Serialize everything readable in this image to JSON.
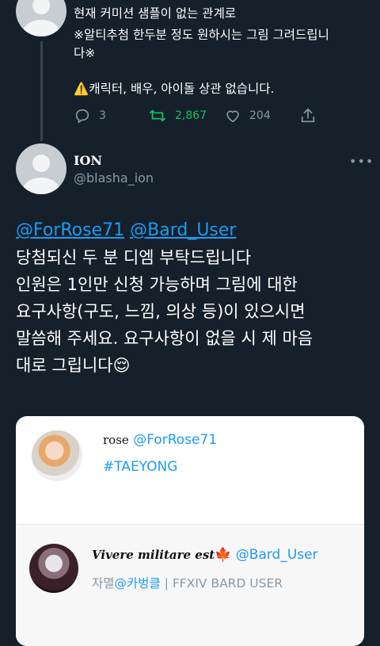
{
  "prev_tweet": {
    "lines": [
      "현재 커미션 샘플이 없는 관계로",
      "※알티추첨 한두분 정도 원하시는 그림 그려드립니",
      "다※"
    ],
    "warning_icon": "⚠️",
    "warning_text": "캐릭터, 배우, 아이돌 상관 없습니다.",
    "actions": {
      "replies": "3",
      "retweets": "2,867",
      "likes": "204"
    }
  },
  "tweet": {
    "name": "ION",
    "handle": "@blasha_ion",
    "more": "•••",
    "mention_1": "@ForRose71",
    "mention_2": "@Bard_User",
    "lines": [
      "당첨되신 두 분 디엠 부탁드립니다",
      "인원은 1인만 신청 가능하며 그림에 대한",
      "요구사항(구도, 느낌, 의상 등)이 있으시면",
      "말씀해 주세요. 요구사항이 없을 시 제 마음",
      "대로 그립니다"
    ],
    "emoji": "😌"
  },
  "card": {
    "user1": {
      "display_name": "rose",
      "handle": "@ForRose71",
      "bio": "#TAEYONG"
    },
    "user2": {
      "display_name": "Vivere militare est",
      "name_emoji": "🍁",
      "handle": "@Bard_User",
      "bio_prefix": "자멸",
      "bio_mention": "@카벙클",
      "bio_rest": " | FFXIV BARD USER"
    }
  },
  "colors": {
    "background": "#15202b",
    "accent": "#1d9bf0",
    "retweet": "#17bf63",
    "muted": "#8899a6"
  }
}
